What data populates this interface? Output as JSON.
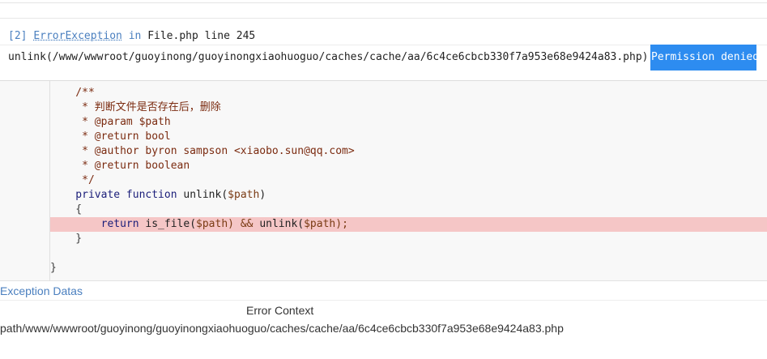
{
  "exception": {
    "index": "[2]",
    "class_name": "ErrorException",
    "in_word": "in",
    "location": "File.php line 245"
  },
  "message": {
    "text": "unlink(/www/wwwroot/guoyinong/guoyinongxiaohuoguo/caches/cache/aa/6c4ce6cbcb330f7a953e68e9424a83.php):",
    "reason": "Permission denied"
  },
  "code": {
    "l1": "    /**",
    "l2": "     * 判断文件是否存在后，删除",
    "l3": "     * @param $path",
    "l4": "     * @return bool",
    "l5": "     * @author byron sampson <xiaobo.sun@qq.com>",
    "l6": "     * @return boolean",
    "l7": "     */",
    "l8_kw": "    private function ",
    "l8_fn": "unlink(",
    "l8_var": "$path",
    "l8_end": ")",
    "l9": "    {",
    "l10_kw": "        return ",
    "l10_a": "is_file(",
    "l10_var1": "$path",
    "l10_b": ") && ",
    "l10_c": "unlink(",
    "l10_var2": "$path",
    "l10_d": ");",
    "l11": "    }",
    "l12": "",
    "l13": "}"
  },
  "datas": {
    "title": "Exception Datas",
    "context_title": "Error Context",
    "path_label": "path",
    "path_value": "/www/wwwroot/guoyinong/guoyinongxiaohuoguo/caches/cache/aa/6c4ce6cbcb330f7a953e68e9424a83.php"
  },
  "colors": {
    "link_blue": "#4a7fbf",
    "badge_blue": "#2d8cf0",
    "highlight_red": "#f5c6c6",
    "code_bg": "#f8f8f8"
  }
}
